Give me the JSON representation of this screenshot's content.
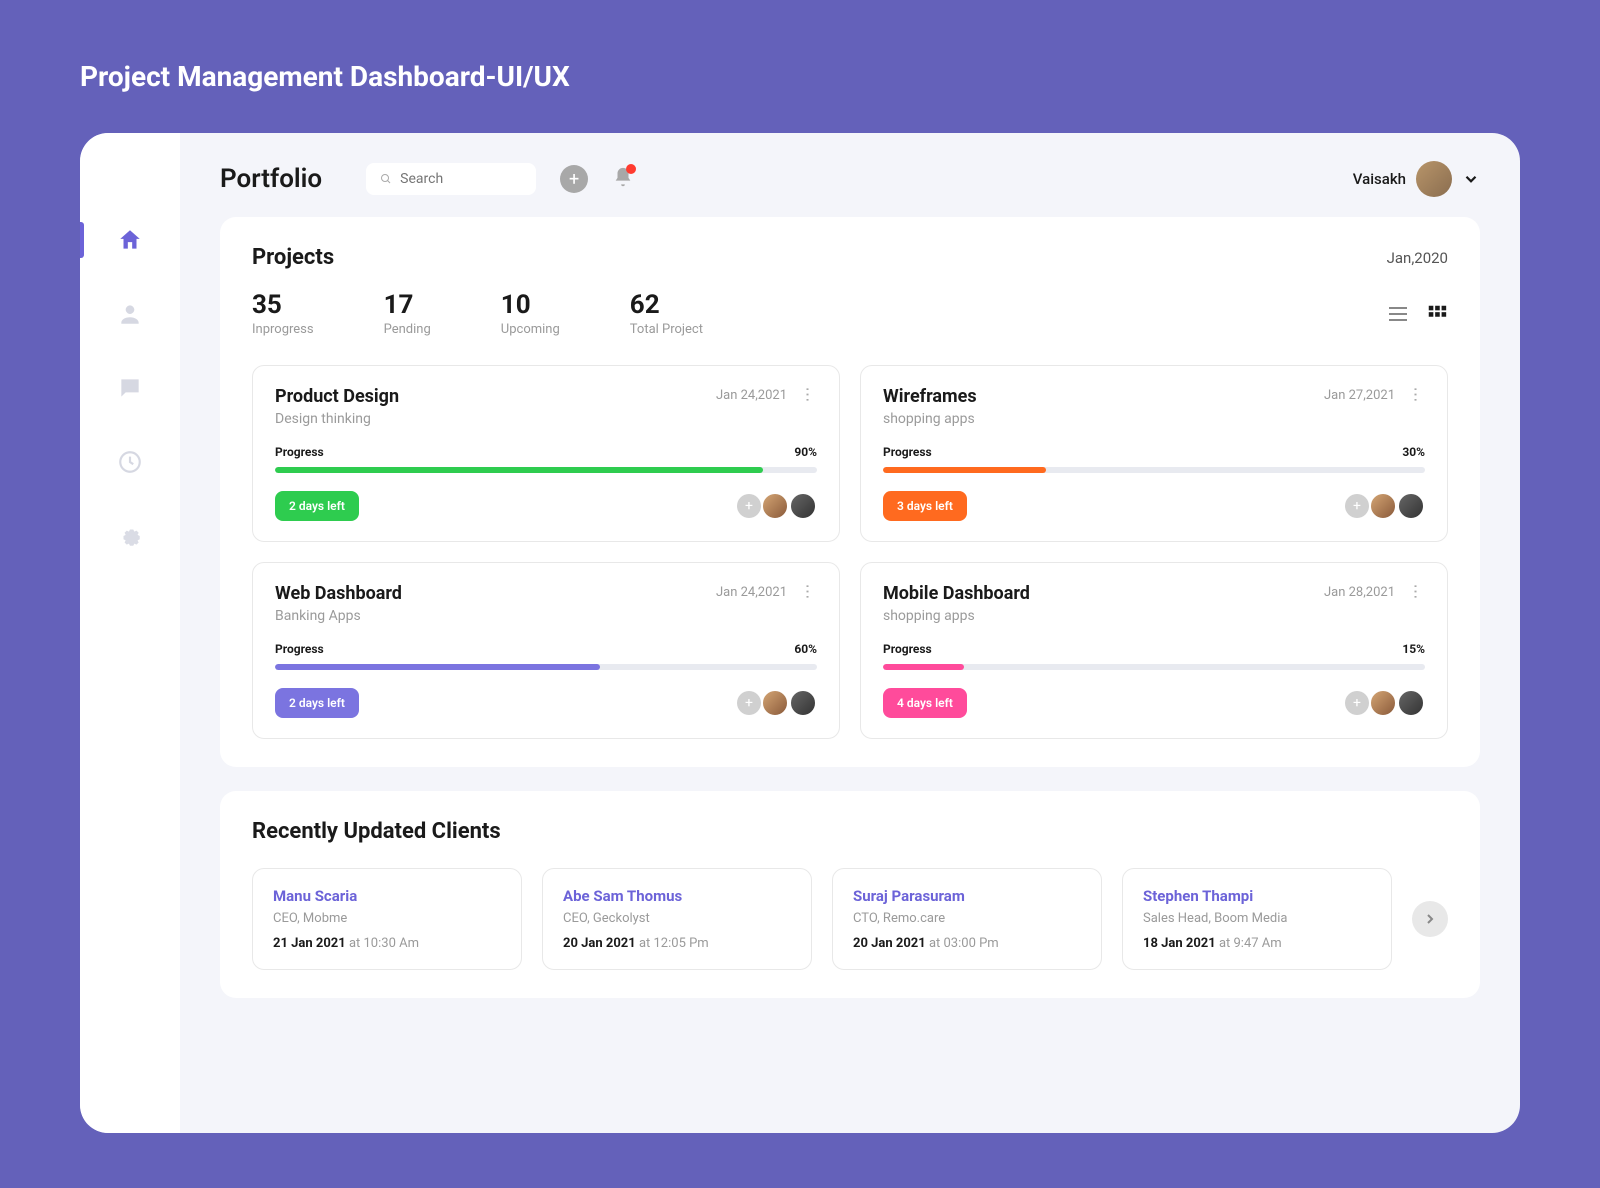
{
  "outer_title": "Project Management Dashboard-UI/UX",
  "header": {
    "page_title": "Portfolio",
    "search_placeholder": "Search",
    "user_name": "Vaisakh"
  },
  "projects_panel": {
    "title": "Projects",
    "date": "Jan,2020",
    "stats": {
      "inprogress": {
        "value": "35",
        "label": "Inprogress"
      },
      "pending": {
        "value": "17",
        "label": "Pending"
      },
      "upcoming": {
        "value": "10",
        "label": "Upcoming"
      },
      "total": {
        "value": "62",
        "label": "Total Project"
      }
    },
    "cards": [
      {
        "title": "Product Design",
        "subtitle": "Design thinking",
        "date": "Jan 24,2021",
        "progress_label": "Progress",
        "progress": "90%",
        "progress_width": "90%",
        "badge": "2 days left",
        "color": "#2ecc4f"
      },
      {
        "title": "Wireframes",
        "subtitle": "shopping apps",
        "date": "Jan 27,2021",
        "progress_label": "Progress",
        "progress": "30%",
        "progress_width": "30%",
        "badge": "3 days left",
        "color": "#ff6a1f"
      },
      {
        "title": "Web Dashboard",
        "subtitle": "Banking Apps",
        "date": "Jan 24,2021",
        "progress_label": "Progress",
        "progress": "60%",
        "progress_width": "60%",
        "badge": "2 days left",
        "color": "#7b74e0"
      },
      {
        "title": "Mobile Dashboard",
        "subtitle": "shopping apps",
        "date": "Jan 28,2021",
        "progress_label": "Progress",
        "progress": "15%",
        "progress_width": "15%",
        "badge": "4 days left",
        "color": "#ff4b9b"
      }
    ]
  },
  "clients_panel": {
    "title": "Recently Updated Clients",
    "at_word": "at",
    "clients": [
      {
        "name": "Manu Scaria",
        "role": "CEO, Mobme",
        "date": "21 Jan 2021",
        "time": "10:30 Am"
      },
      {
        "name": "Abe Sam Thomus",
        "role": "CEO, Geckolyst",
        "date": "20 Jan 2021",
        "time": "12:05 Pm"
      },
      {
        "name": "Suraj Parasuram",
        "role": "CTO, Remo.care",
        "date": "20 Jan 2021",
        "time": "03:00 Pm"
      },
      {
        "name": "Stephen Thampi",
        "role": "Sales Head, Boom Media",
        "date": "18 Jan 2021",
        "time": "9:47 Am"
      }
    ]
  }
}
